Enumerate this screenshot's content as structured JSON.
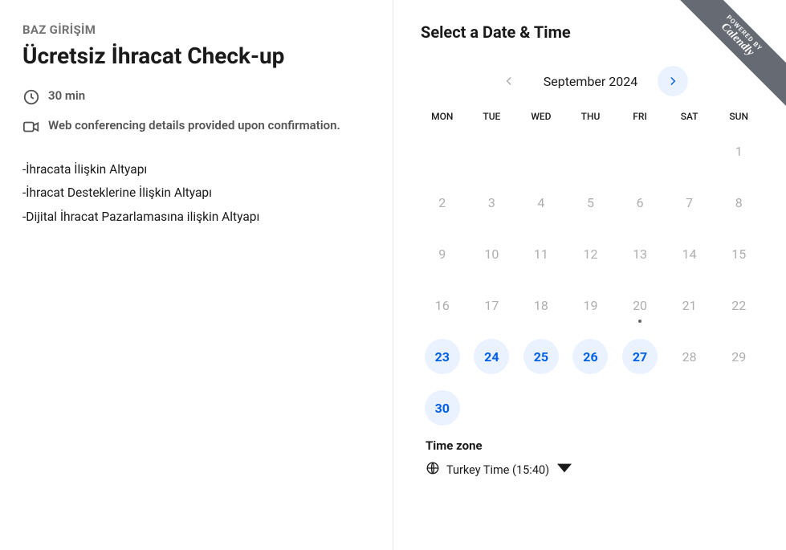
{
  "organizer": "BAZ GİRİŞİM",
  "event_title": "Ücretsiz İhracat Check-up",
  "duration": "30 min",
  "location_note": "Web conferencing details provided upon confirmation.",
  "description_lines": [
    "-İhracata İlişkin Altyapı",
    "-İhracat Desteklerine İlişkin Altyapı",
    "-Dijital İhracat Pazarlamasına ilişkin Altyapı"
  ],
  "right_title": "Select a Date & Time",
  "month_label": "September 2024",
  "day_headers": [
    "MON",
    "TUE",
    "WED",
    "THU",
    "FRI",
    "SAT",
    "SUN"
  ],
  "calendar_weeks": [
    [
      null,
      null,
      null,
      null,
      null,
      null,
      {
        "d": 1,
        "available": false
      }
    ],
    [
      {
        "d": 2
      },
      {
        "d": 3
      },
      {
        "d": 4
      },
      {
        "d": 5
      },
      {
        "d": 6
      },
      {
        "d": 7
      },
      {
        "d": 8
      }
    ],
    [
      {
        "d": 9
      },
      {
        "d": 10
      },
      {
        "d": 11
      },
      {
        "d": 12
      },
      {
        "d": 13
      },
      {
        "d": 14
      },
      {
        "d": 15
      }
    ],
    [
      {
        "d": 16
      },
      {
        "d": 17
      },
      {
        "d": 18
      },
      {
        "d": 19
      },
      {
        "d": 20,
        "today": true
      },
      {
        "d": 21
      },
      {
        "d": 22
      }
    ],
    [
      {
        "d": 23,
        "available": true
      },
      {
        "d": 24,
        "available": true
      },
      {
        "d": 25,
        "available": true
      },
      {
        "d": 26,
        "available": true
      },
      {
        "d": 27,
        "available": true
      },
      {
        "d": 28
      },
      {
        "d": 29
      }
    ],
    [
      {
        "d": 30,
        "available": true
      },
      null,
      null,
      null,
      null,
      null,
      null
    ]
  ],
  "timezone": {
    "title": "Time zone",
    "label": "Turkey Time (15:40)"
  },
  "badge": {
    "small": "POWERED BY",
    "big": "Calendly"
  },
  "colors": {
    "accent": "#0060e6",
    "accent_bg": "#eaf2ff"
  }
}
